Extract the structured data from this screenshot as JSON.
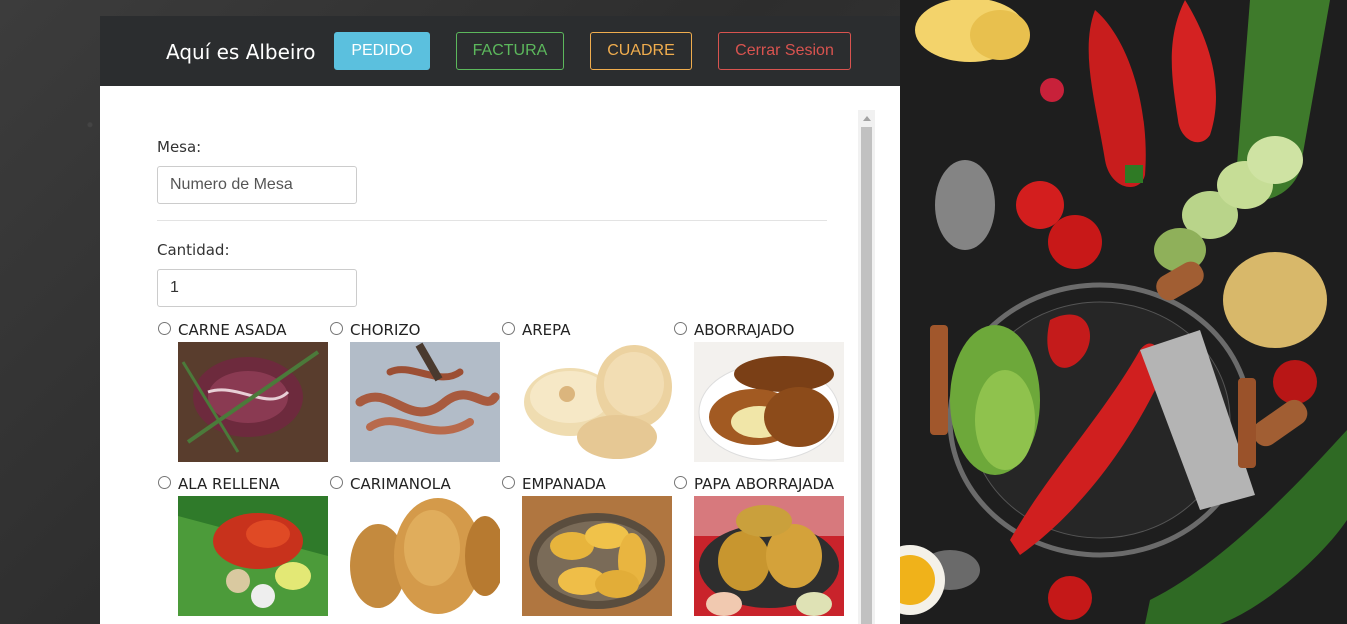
{
  "navbar": {
    "brand": "Aquí es Albeiro",
    "buttons": {
      "pedido": "PEDIDO",
      "factura": "FACTURA",
      "cuadre": "CUADRE",
      "cerrar": "Cerrar Sesion"
    }
  },
  "form": {
    "mesa_label": "Mesa:",
    "mesa_placeholder": "Numero de Mesa",
    "cantidad_label": "Cantidad:",
    "cantidad_value": "1"
  },
  "products": [
    {
      "name": "CARNE ASADA"
    },
    {
      "name": "CHORIZO"
    },
    {
      "name": "AREPA"
    },
    {
      "name": "ABORRAJADO"
    },
    {
      "name": "ALA RELLENA"
    },
    {
      "name": "CARIMANOLA"
    },
    {
      "name": "EMPANADA"
    },
    {
      "name": "PAPA ABORRAJADA"
    }
  ],
  "colors": {
    "navbar_bg": "#2b2d2f",
    "info": "#5bc0de",
    "success": "#5cb85c",
    "warning": "#f0ad4e",
    "danger": "#d9534f"
  }
}
